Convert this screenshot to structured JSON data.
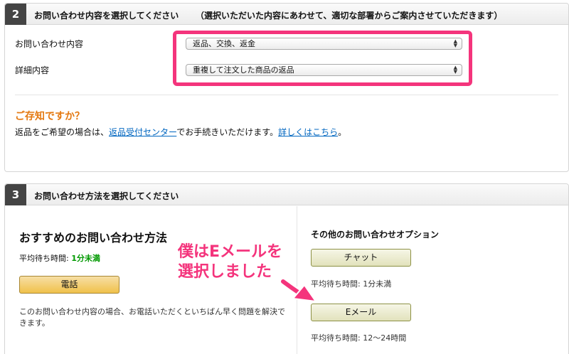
{
  "section2": {
    "number": "2",
    "title": "お問い合わせ内容を選択してください",
    "note": "（選択いただいた内容にあわせて、適切な部署からご案内させていただきます）",
    "inquiry_label": "お問い合わせ内容",
    "inquiry_value": "返品、交換、返金",
    "detail_label": "詳細内容",
    "detail_value": "重複して注文した商品の返品",
    "info_title": "ご存知ですか？",
    "info_text_before": "返品をご希望の場合は、",
    "info_link1": "返品受付センター",
    "info_text_middle": "でお手続きいただけます。",
    "info_link2": "詳しくはこちら",
    "info_text_end": "。"
  },
  "section3": {
    "number": "3",
    "title": "お問い合わせ方法を選択してください",
    "recommended_title": "おすすめのお問い合わせ方法",
    "wait_label": "平均待ち時間: ",
    "wait_phone": "1分未満",
    "phone_button": "電話",
    "phone_desc": "このお問い合わせ内容の場合、お電話いただくといちばん早く問題を解決できます。",
    "other_title": "その他のお問い合わせオプション",
    "chat_button": "チャット",
    "chat_wait": "平均待ち時間: 1分未満",
    "email_button": "Eメール",
    "email_wait": "平均待ち時間: 12〜24時間"
  },
  "annotation": {
    "line1": "僕はEメールを",
    "line2": "選択しました",
    "color": "#f4347c"
  }
}
